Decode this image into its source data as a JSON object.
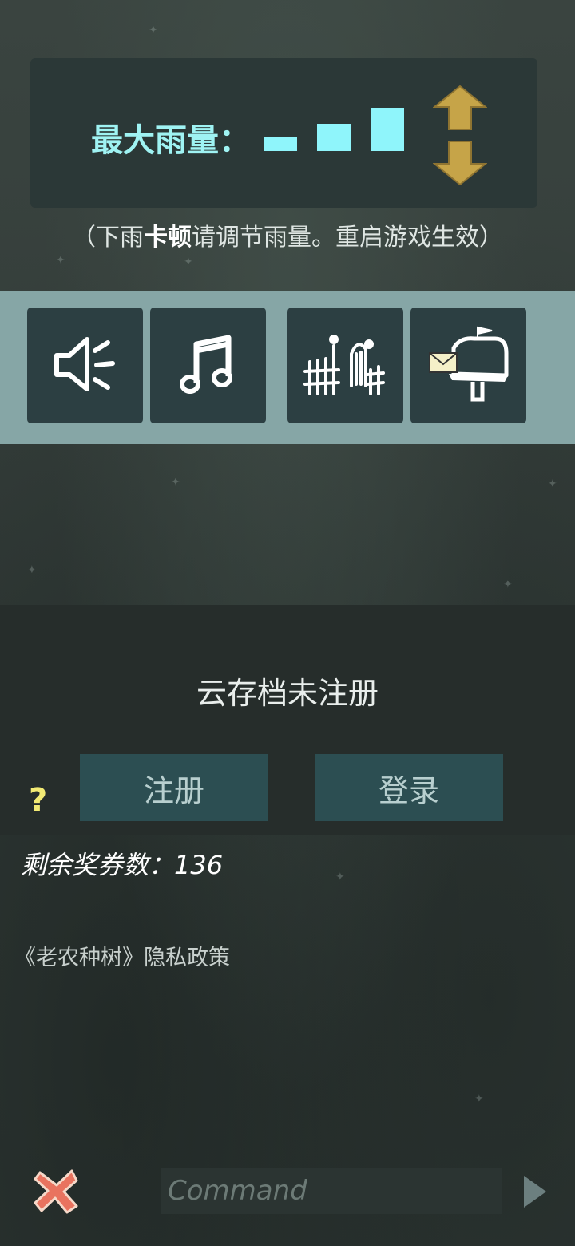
{
  "rain": {
    "label": "最大雨量：",
    "level": 3,
    "levels": 3,
    "hint_prefix": "（下雨",
    "hint_bold": "卡顿",
    "hint_suffix": "请调节雨量。重启游戏生效）",
    "bar_color": "#8ff5fb",
    "arrow_color": "#c6a448"
  },
  "icons": [
    {
      "name": "sound",
      "icon": "speaker-icon"
    },
    {
      "name": "music",
      "icon": "music-note-icon"
    },
    {
      "name": "fence",
      "icon": "fence-icon"
    },
    {
      "name": "mail",
      "icon": "mailbox-icon"
    }
  ],
  "cloud": {
    "title": "云存档未注册",
    "register_label": "注册",
    "login_label": "登录",
    "help_label": "?"
  },
  "coupons": {
    "text": "剩余奖券数：136"
  },
  "privacy": {
    "text": "《老农种树》隐私政策"
  },
  "command": {
    "placeholder": "Command",
    "value": ""
  }
}
